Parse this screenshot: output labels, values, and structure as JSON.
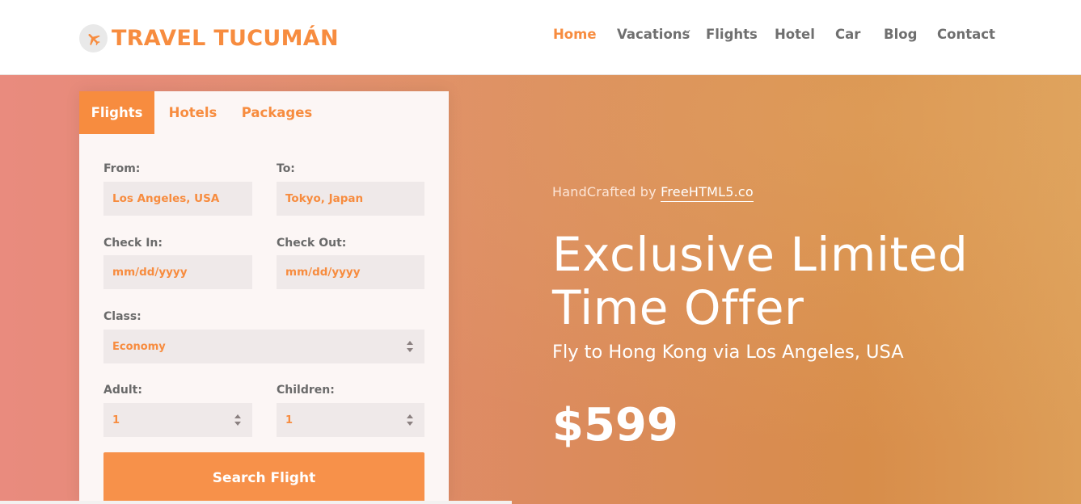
{
  "brand": {
    "name": "TRAVEL TUCUMÁN",
    "icon": "airplane-icon"
  },
  "nav": {
    "items": [
      {
        "label": "Home",
        "active": true
      },
      {
        "label": "Vacations",
        "active": false,
        "has_dropdown": true
      },
      {
        "label": "Flights",
        "active": false
      },
      {
        "label": "Hotel",
        "active": false
      },
      {
        "label": "Car",
        "active": false
      },
      {
        "label": "Blog",
        "active": false
      },
      {
        "label": "Contact",
        "active": false
      }
    ]
  },
  "booking": {
    "tabs": [
      {
        "label": "Flights",
        "active": true
      },
      {
        "label": "Hotels",
        "active": false
      },
      {
        "label": "Packages",
        "active": false
      }
    ],
    "from": {
      "label": "From:",
      "value": "Los Angeles, USA"
    },
    "to": {
      "label": "To:",
      "value": "Tokyo, Japan"
    },
    "check_in": {
      "label": "Check In:",
      "placeholder": "mm/dd/yyyy"
    },
    "check_out": {
      "label": "Check Out:",
      "placeholder": "mm/dd/yyyy"
    },
    "class": {
      "label": "Class:",
      "value": "Economy"
    },
    "adult": {
      "label": "Adult:",
      "value": "1"
    },
    "children": {
      "label": "Children:",
      "value": "1"
    },
    "search_label": "Search Flight"
  },
  "hero": {
    "credit_prefix": "HandCrafted by",
    "credit_link": "FreeHTML5.co",
    "title": "Exclusive Limited Time Offer",
    "subtitle": "Fly to Hong Kong via Los Angeles, USA",
    "price": "$599"
  },
  "colors": {
    "accent": "#f78c3f",
    "panel": "#fcf6f5",
    "field": "#efe9e9",
    "nav_text": "#6f6f6f"
  }
}
